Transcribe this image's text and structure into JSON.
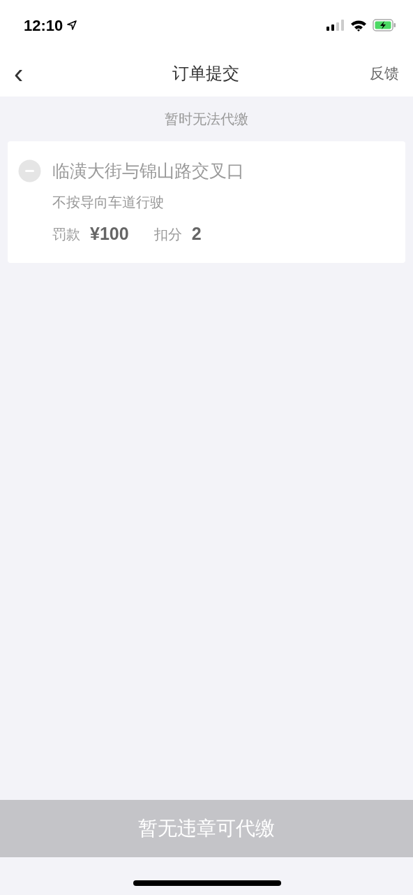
{
  "status_bar": {
    "time": "12:10"
  },
  "nav": {
    "back": "‹",
    "title": "订单提交",
    "action": "反馈"
  },
  "section_title": "暂时无法代缴",
  "violations": [
    {
      "location": "临潢大街与锦山路交叉口",
      "reason": "不按导向车道行驶",
      "fine_label": "罚款",
      "fine": "¥100",
      "points_label": "扣分",
      "points": "2",
      "disabled": true
    }
  ],
  "submit_button": {
    "label": "暂无违章可代缴",
    "disabled": true
  }
}
